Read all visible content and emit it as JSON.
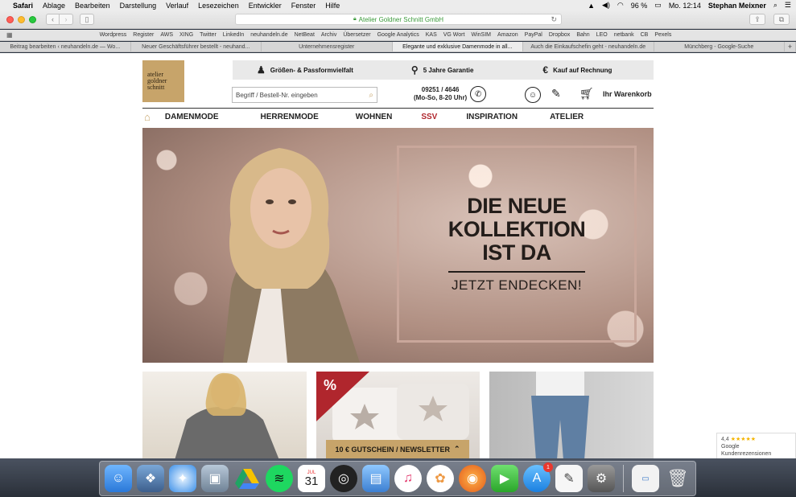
{
  "menubar": {
    "app": "Safari",
    "items": [
      "Ablage",
      "Bearbeiten",
      "Darstellung",
      "Verlauf",
      "Lesezeichen",
      "Entwickler",
      "Fenster",
      "Hilfe"
    ],
    "battery": "96 %",
    "clock": "Mo. 12:14",
    "user": "Stephan Meixner"
  },
  "toolbar": {
    "url": "Atelier Goldner Schnitt GmbH"
  },
  "bookmarks": [
    "Wordpress",
    "Register",
    "AWS",
    "XING",
    "Twitter",
    "LinkedIn",
    "neuhandeln.de",
    "NetBeat",
    "Archiv",
    "Übersetzer",
    "Google Analytics",
    "KAS",
    "VG Wort",
    "WinSIM",
    "Amazon",
    "PayPal",
    "Dropbox",
    "Bahn",
    "LEO",
    "netbank",
    "CB",
    "Pexels"
  ],
  "tabs": [
    {
      "label": "Beitrag bearbeiten ‹ neuhandeln.de — Wo..."
    },
    {
      "label": "Neuer Geschäftsführer bestellt - neuhand..."
    },
    {
      "label": "Unternehmensregister"
    },
    {
      "label": "Elegante und exklusive Damenmode in all..."
    },
    {
      "label": "Auch die Einkaufschefin geht - neuhandeln.de"
    },
    {
      "label": "Münchberg - Google-Suche"
    }
  ],
  "site": {
    "logo_lines": [
      "atelier",
      "goldner",
      "schnitt"
    ],
    "usps": [
      {
        "icon": "dress-form-icon",
        "label": "Größen- & Passformvielfalt"
      },
      {
        "icon": "guarantee-icon",
        "label": "5 Jahre Garantie"
      },
      {
        "icon": "invoice-icon",
        "label": "Kauf auf Rechnung"
      }
    ],
    "search_placeholder": "Begriff / Bestell-Nr. eingeben",
    "phone_number": "09251 / 4646",
    "phone_hours": "(Mo-So, 8-20 Uhr)",
    "cart_label": "Ihr Warenkorb",
    "nav": [
      "DAMENMODE",
      "HERRENMODE",
      "WOHNEN",
      "SSV",
      "INSPIRATION",
      "ATELIER"
    ],
    "hero_headline_lines": [
      "DIE NEUE",
      "KOLLEKTION",
      "IST DA"
    ],
    "hero_cta": "JETZT ENDECKEN!",
    "sale_badge": "%",
    "newsletter_label": "10 € GUTSCHEIN / NEWSLETTER",
    "reviews": {
      "rating": "4,4",
      "stars": "★★★★★",
      "brand": "Google",
      "label": "Kundenrezensionen"
    }
  },
  "dock": {
    "calendar_month": "JUL",
    "calendar_day": "31",
    "appstore_badge": "1"
  },
  "colors": {
    "gold": "#c7a46a",
    "sale_red": "#b0262d"
  }
}
